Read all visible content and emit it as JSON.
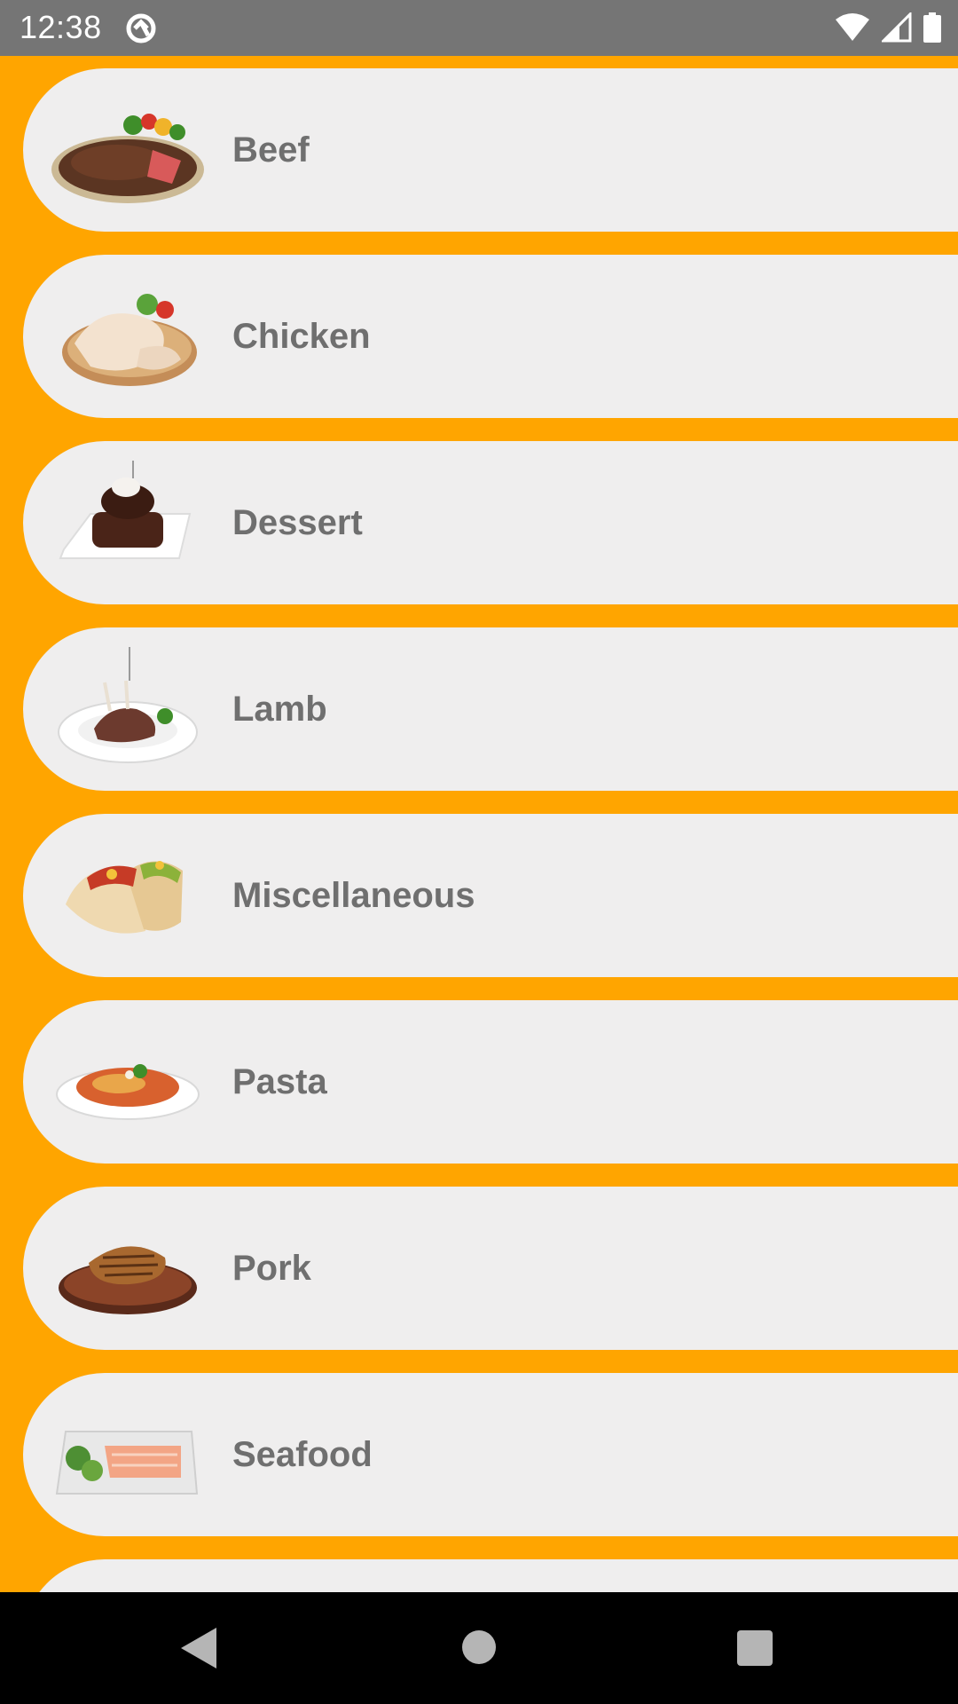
{
  "status_bar": {
    "time": "12:38",
    "app_icon": "app-notification-icon",
    "icons": [
      "wifi-icon",
      "cellular-signal-icon",
      "battery-icon"
    ]
  },
  "theme": {
    "background": "#ffa500",
    "card": "#efeeee",
    "label": "#6f6f6f",
    "status_bar": "#757575",
    "nav_bar": "#000000"
  },
  "categories": [
    {
      "label": "Beef",
      "image": "steak-image"
    },
    {
      "label": "Chicken",
      "image": "chicken-image"
    },
    {
      "label": "Dessert",
      "image": "chocolate-cake-image"
    },
    {
      "label": "Lamb",
      "image": "lamb-chops-image"
    },
    {
      "label": "Miscellaneous",
      "image": "tacos-image"
    },
    {
      "label": "Pasta",
      "image": "pasta-image"
    },
    {
      "label": "Pork",
      "image": "pork-chop-image"
    },
    {
      "label": "Seafood",
      "image": "salmon-plate-image"
    },
    {
      "label": "",
      "image": ""
    }
  ],
  "nav_bar": {
    "buttons": [
      "back-icon",
      "home-icon",
      "recents-icon"
    ]
  }
}
